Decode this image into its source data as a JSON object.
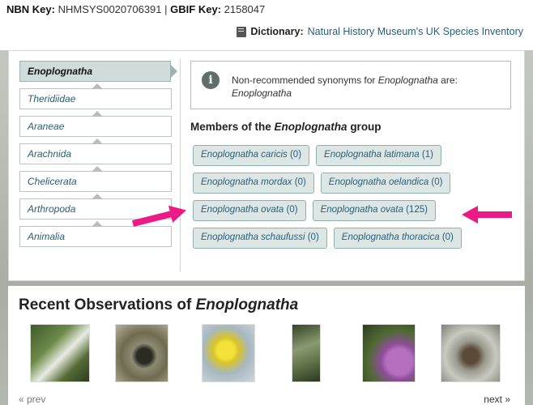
{
  "header": {
    "nbn_key_label": "NBN Key:",
    "nbn_key_value": "NHMSYS0020706391",
    "separator": "|",
    "gbif_key_label": "GBIF Key:",
    "gbif_key_value": "2158047",
    "dictionary_label": "Dictionary:",
    "dictionary_link": "Natural History Museum's UK Species Inventory",
    "dictionary_icon": "book-icon"
  },
  "lineage": {
    "current": "Enoplognatha",
    "items": [
      "Theridiidae",
      "Araneae",
      "Arachnida",
      "Chelicerata",
      "Arthropoda",
      "Animalia"
    ]
  },
  "info": {
    "icon": "info-icon",
    "text_prefix": "Non-recommended synonyms for",
    "genus": "Enoplognatha",
    "text_suffix": "are:",
    "synonym": "Enoplognatha"
  },
  "members": {
    "title_prefix": "Members of the",
    "genus": "Enoplognatha",
    "title_suffix": "group",
    "rows": [
      [
        {
          "name": "Enoplognatha caricis",
          "count": "(0)"
        },
        {
          "name": "Enoplognatha latimana",
          "count": "(1)"
        }
      ],
      [
        {
          "name": "Enoplognatha mordax",
          "count": "(0)"
        },
        {
          "name": "Enoplognatha oelandica",
          "count": "(0)"
        }
      ],
      [
        {
          "name": "Enoplognatha ovata",
          "count": "(0)"
        },
        {
          "name": "Enoplognatha ovata",
          "count": "(125)"
        }
      ],
      [
        {
          "name": "Enoplognatha schaufussi",
          "count": "(0)"
        },
        {
          "name": "Enoplognatha thoracica",
          "count": "(0)"
        }
      ]
    ]
  },
  "annotation": {
    "arrow_color": "#ec1a85"
  },
  "recent": {
    "title_prefix": "Recent Observations of",
    "genus": "Enoplognatha",
    "prev": "« prev",
    "next": "next »"
  },
  "colors": {
    "link": "#2a5e75",
    "chip_bg": "#dce6e5",
    "chip_border": "#8fb0ad",
    "current_bg": "#cfdcdb"
  }
}
